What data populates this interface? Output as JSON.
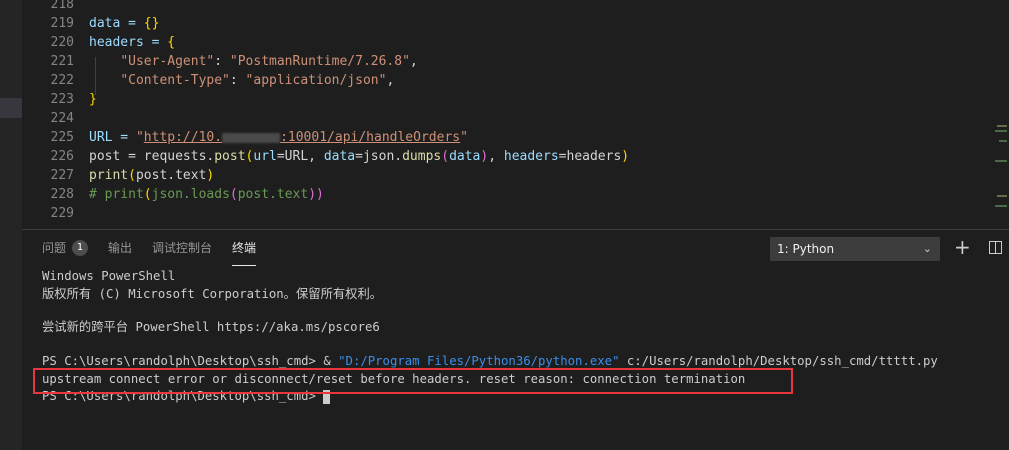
{
  "editor": {
    "lines": [
      {
        "n": "218"
      },
      {
        "n": "219",
        "t": [
          "data = ",
          "{}"
        ]
      },
      {
        "n": "220",
        "t": [
          "headers = ",
          "{"
        ]
      },
      {
        "n": "221",
        "t": [
          "    ",
          "\"User-Agent\"",
          ": ",
          "\"PostmanRuntime/7.26.8\"",
          ","
        ]
      },
      {
        "n": "222",
        "t": [
          "    ",
          "\"Content-Type\"",
          ": ",
          "\"application/json\"",
          ","
        ]
      },
      {
        "n": "223",
        "t": [
          "}"
        ]
      },
      {
        "n": "224"
      },
      {
        "n": "225",
        "t": [
          "URL = ",
          "\"",
          "http://10.",
          ":10001/api/handleOrders",
          "\""
        ]
      },
      {
        "n": "226",
        "t": [
          "post = requests.",
          "post",
          "(",
          "url",
          "=URL, ",
          "data",
          "=json.",
          "dumps",
          "(",
          "data",
          ")",
          ", ",
          "headers",
          "=headers",
          ")"
        ]
      },
      {
        "n": "227",
        "t": [
          "print",
          "(",
          "post.text",
          ")"
        ]
      },
      {
        "n": "228",
        "t": [
          "# print",
          "(",
          "json.loads",
          "(",
          "post.text",
          "))"
        ]
      },
      {
        "n": "229"
      }
    ]
  },
  "panel": {
    "tabs": [
      {
        "label": "问题",
        "badge": "1"
      },
      {
        "label": "输出"
      },
      {
        "label": "调试控制台"
      },
      {
        "label": "终端"
      }
    ],
    "terminal_select": "1: Python",
    "terminal": {
      "l1": "Windows PowerShell",
      "l2": "版权所有 (C) Microsoft Corporation。保留所有权利。",
      "l3": "尝试新的跨平台 PowerShell https://aka.ms/pscore6",
      "l4a": "PS C:\\Users\\randolph\\Desktop\\ssh_cmd> & ",
      "l4b": "\"D:/Program Files/Python36/python.exe\"",
      "l4c": " c:/Users/randolph/Desktop/ssh_cmd/ttttt.py",
      "l5": "upstream connect error or disconnect/reset before headers. reset reason: connection termination",
      "l6": "PS C:\\Users\\randolph\\Desktop\\ssh_cmd> "
    }
  }
}
